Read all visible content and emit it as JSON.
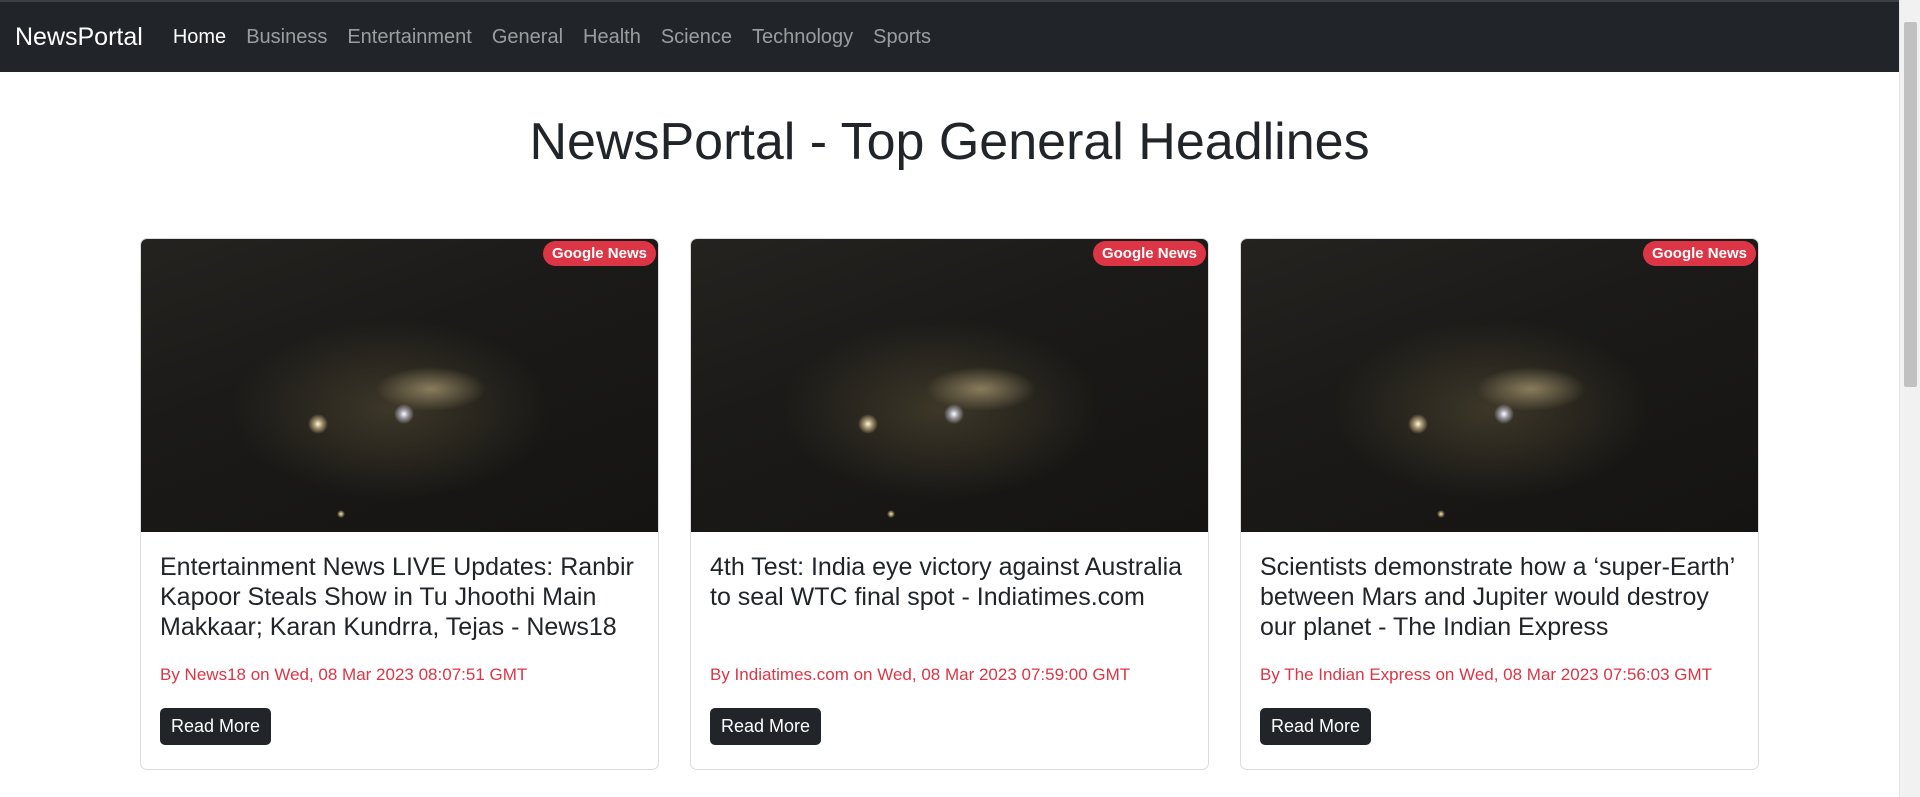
{
  "navbar": {
    "brand": "NewsPortal",
    "links": [
      {
        "label": "Home",
        "active": true
      },
      {
        "label": "Business",
        "active": false
      },
      {
        "label": "Entertainment",
        "active": false
      },
      {
        "label": "General",
        "active": false
      },
      {
        "label": "Health",
        "active": false
      },
      {
        "label": "Science",
        "active": false
      },
      {
        "label": "Technology",
        "active": false
      },
      {
        "label": "Sports",
        "active": false
      }
    ]
  },
  "main": {
    "title": "NewsPortal - Top General Headlines"
  },
  "cards": [
    {
      "badge": "Google News",
      "title": "Entertainment News LIVE Updates: Ranbir Kapoor Steals Show in Tu Jhoothi Main Makkaar; Karan Kundrra, Tejas - News18",
      "meta": "By News18 on Wed, 08 Mar 2023 08:07:51 GMT",
      "button": "Read More"
    },
    {
      "badge": "Google News",
      "title": "4th Test: India eye victory against Australia to seal WTC final spot - Indiatimes.com",
      "meta": "By Indiatimes.com on Wed, 08 Mar 2023 07:59:00 GMT",
      "button": "Read More"
    },
    {
      "badge": "Google News",
      "title": "Scientists demonstrate how a ‘super-Earth’ between Mars and Jupiter would destroy our planet - The Indian Express",
      "meta": "By The Indian Express on Wed, 08 Mar 2023 07:56:03 GMT",
      "button": "Read More"
    }
  ],
  "colors": {
    "navbar_bg": "#212529",
    "badge_bg": "#dc3545",
    "meta_text": "#dc3545",
    "button_bg": "#212529"
  }
}
